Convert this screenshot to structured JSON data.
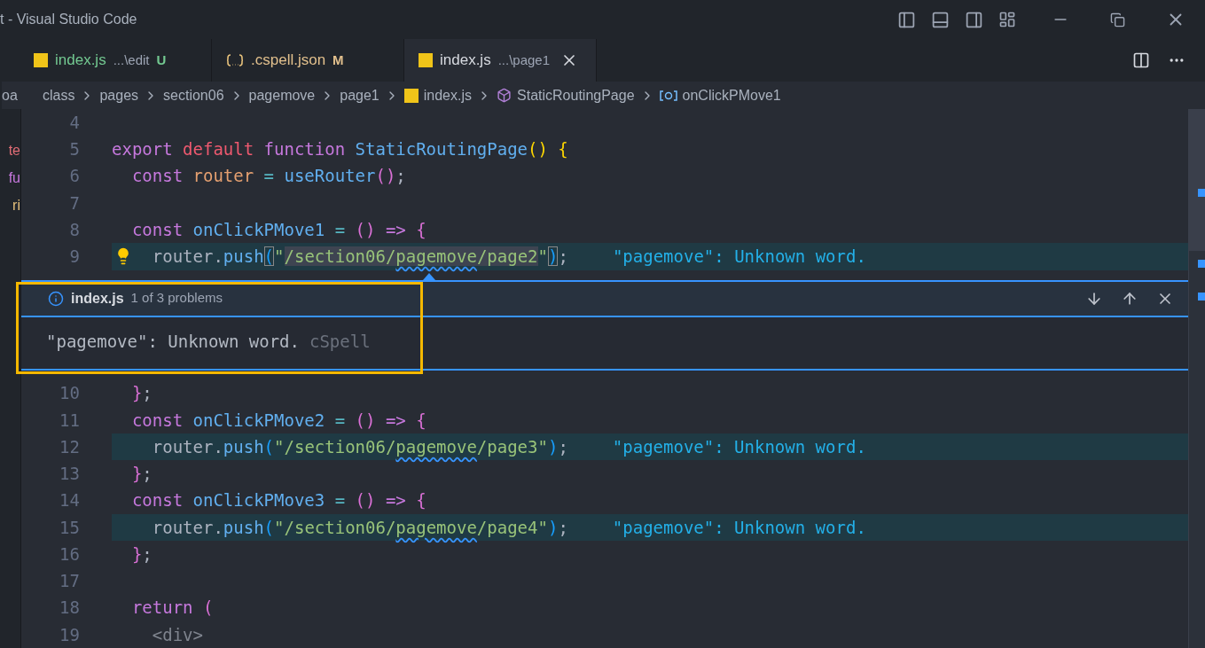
{
  "window": {
    "title": "t - Visual Studio Code"
  },
  "tabs": [
    {
      "name": "index.js",
      "path": "...\\edit",
      "badge": "U",
      "kind": "js",
      "color": "#73c991",
      "selected": false
    },
    {
      "name": ".cspell.json",
      "badge": "M",
      "kind": "json",
      "color": "#e2c08d",
      "selected": false
    },
    {
      "name": "index.js",
      "path": "...\\page1",
      "kind": "js",
      "color": "#d7dae0",
      "selected": true
    }
  ],
  "sidebar_fragments": [
    {
      "text": "te",
      "color": "#e06c75"
    },
    {
      "text": "fu",
      "color": "#c678dd"
    },
    {
      "text": "ri",
      "color": "#e5c07b"
    }
  ],
  "breadcrumbs": [
    {
      "text": "oa",
      "kind": "cut"
    },
    {
      "text": "class",
      "kind": "folder"
    },
    {
      "text": "pages",
      "kind": "folder"
    },
    {
      "text": "section06",
      "kind": "folder"
    },
    {
      "text": "pagemove",
      "kind": "folder"
    },
    {
      "text": "page1",
      "kind": "folder"
    },
    {
      "text": "index.js",
      "kind": "file"
    },
    {
      "text": "StaticRoutingPage",
      "kind": "class"
    },
    {
      "text": "onClickPMove1",
      "kind": "method"
    }
  ],
  "lines_before": [
    {
      "num": "4",
      "highlighted": false,
      "lightbulb": false
    },
    {
      "num": "5",
      "highlighted": false,
      "lightbulb": false,
      "tokens": [
        {
          "t": "export ",
          "kind": "keyword"
        },
        {
          "t": "default ",
          "kind": "keyword_red"
        },
        {
          "t": "function ",
          "kind": "keyword"
        },
        {
          "t": "StaticRoutingPage",
          "kind": "function"
        },
        {
          "t": "() {",
          "kind": "bracket_yellow"
        }
      ]
    },
    {
      "num": "6",
      "highlighted": false,
      "lightbulb": false,
      "tokens": [
        {
          "t": "  const ",
          "kind": "keyword"
        },
        {
          "t": "router",
          "kind": "variable"
        },
        {
          "t": " = ",
          "kind": "operator"
        },
        {
          "t": "useRouter",
          "kind": "function"
        },
        {
          "t": "()",
          "kind": "bracket_pink"
        },
        {
          "t": ";",
          "kind": "plain"
        }
      ]
    },
    {
      "num": "7",
      "highlighted": false,
      "lightbulb": false
    },
    {
      "num": "8",
      "highlighted": false,
      "lightbulb": false,
      "tokens": [
        {
          "t": "  const ",
          "kind": "keyword"
        },
        {
          "t": "onClickPMove1",
          "kind": "function"
        },
        {
          "t": " = ",
          "kind": "operator"
        },
        {
          "t": "()",
          "kind": "bracket_pink"
        },
        {
          "t": " => ",
          "kind": "keyword"
        },
        {
          "t": "{",
          "kind": "bracket_pink"
        }
      ]
    },
    {
      "num": "9",
      "highlighted": true,
      "lightbulb": true,
      "diagnostic": "\"pagemove\": Unknown word.",
      "tokens": [
        {
          "t": "    router",
          "kind": "plain"
        },
        {
          "t": ".",
          "kind": "plain"
        },
        {
          "t": "push",
          "kind": "function"
        },
        {
          "t": "(",
          "kind": "bracket_match"
        },
        {
          "t": "\"",
          "kind": "string"
        },
        {
          "t": "/section06/",
          "kind": "string_selected"
        },
        {
          "t": "pagemove",
          "kind": "string_selected_error"
        },
        {
          "t": "/page2",
          "kind": "string_selected"
        },
        {
          "t": "\"",
          "kind": "string"
        },
        {
          "t": ")",
          "kind": "bracket_match"
        },
        {
          "t": ";",
          "kind": "plain"
        }
      ]
    }
  ],
  "problem": {
    "file": "index.js",
    "count": "1 of 3 problems",
    "message": "\"pagemove\": Unknown word.",
    "source": "cSpell"
  },
  "lines_after": [
    {
      "num": "10",
      "highlighted": false,
      "lightbulb": false,
      "tokens": [
        {
          "t": "  }",
          "kind": "bracket_pink"
        },
        {
          "t": ";",
          "kind": "plain"
        }
      ]
    },
    {
      "num": "11",
      "highlighted": false,
      "lightbulb": false,
      "tokens": [
        {
          "t": "  const ",
          "kind": "keyword"
        },
        {
          "t": "onClickPMove2",
          "kind": "function"
        },
        {
          "t": " = ",
          "kind": "operator"
        },
        {
          "t": "()",
          "kind": "bracket_pink"
        },
        {
          "t": " => ",
          "kind": "keyword"
        },
        {
          "t": "{",
          "kind": "bracket_pink"
        }
      ]
    },
    {
      "num": "12",
      "highlighted": true,
      "lightbulb": false,
      "diagnostic": "\"pagemove\": Unknown word.",
      "tokens": [
        {
          "t": "    router",
          "kind": "plain"
        },
        {
          "t": ".",
          "kind": "plain"
        },
        {
          "t": "push",
          "kind": "function"
        },
        {
          "t": "(",
          "kind": "bracket_blue"
        },
        {
          "t": "\"/section06/",
          "kind": "string"
        },
        {
          "t": "pagemove",
          "kind": "string_error"
        },
        {
          "t": "/page3\"",
          "kind": "string"
        },
        {
          "t": ")",
          "kind": "bracket_blue"
        },
        {
          "t": ";",
          "kind": "plain"
        }
      ]
    },
    {
      "num": "13",
      "highlighted": false,
      "lightbulb": false,
      "tokens": [
        {
          "t": "  }",
          "kind": "bracket_pink"
        },
        {
          "t": ";",
          "kind": "plain"
        }
      ]
    },
    {
      "num": "14",
      "highlighted": false,
      "lightbulb": false,
      "tokens": [
        {
          "t": "  const ",
          "kind": "keyword"
        },
        {
          "t": "onClickPMove3",
          "kind": "function"
        },
        {
          "t": " = ",
          "kind": "operator"
        },
        {
          "t": "()",
          "kind": "bracket_pink"
        },
        {
          "t": " => ",
          "kind": "keyword"
        },
        {
          "t": "{",
          "kind": "bracket_pink"
        }
      ]
    },
    {
      "num": "15",
      "highlighted": true,
      "lightbulb": false,
      "diagnostic": "\"pagemove\": Unknown word.",
      "tokens": [
        {
          "t": "    router",
          "kind": "plain"
        },
        {
          "t": ".",
          "kind": "plain"
        },
        {
          "t": "push",
          "kind": "function"
        },
        {
          "t": "(",
          "kind": "bracket_blue"
        },
        {
          "t": "\"/section06/",
          "kind": "string"
        },
        {
          "t": "pagemove",
          "kind": "string_error"
        },
        {
          "t": "/page4\"",
          "kind": "string"
        },
        {
          "t": ")",
          "kind": "bracket_blue"
        },
        {
          "t": ";",
          "kind": "plain"
        }
      ]
    },
    {
      "num": "16",
      "highlighted": false,
      "lightbulb": false,
      "tokens": [
        {
          "t": "  }",
          "kind": "bracket_pink"
        },
        {
          "t": ";",
          "kind": "plain"
        }
      ]
    },
    {
      "num": "17",
      "highlighted": false,
      "lightbulb": false
    },
    {
      "num": "18",
      "highlighted": false,
      "lightbulb": false,
      "tokens": [
        {
          "t": "  return ",
          "kind": "keyword"
        },
        {
          "t": "(",
          "kind": "bracket_pink"
        }
      ]
    },
    {
      "num": "19",
      "highlighted": false,
      "lightbulb": false,
      "tokens": [
        {
          "t": "    <div>",
          "kind": "tag"
        }
      ]
    }
  ]
}
